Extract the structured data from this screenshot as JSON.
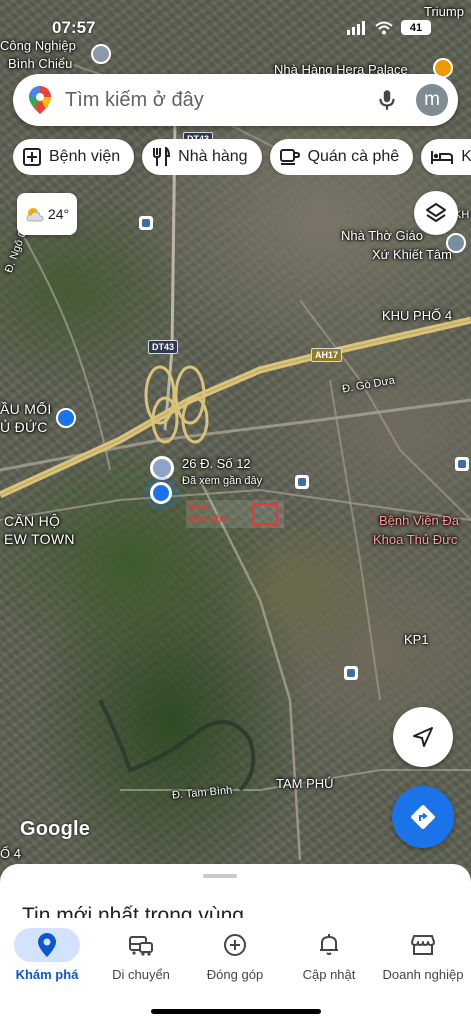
{
  "status_bar": {
    "time": "07:57",
    "battery": "41"
  },
  "search": {
    "placeholder": "Tìm kiếm ở đây",
    "avatar_letter": "m"
  },
  "chips": [
    {
      "label": "Bệnh viện",
      "icon": "hospital-icon"
    },
    {
      "label": "Nhà hàng",
      "icon": "restaurant-icon"
    },
    {
      "label": "Quán cà phê",
      "icon": "coffee-icon"
    },
    {
      "label": "Kh",
      "icon": "hotel-icon"
    }
  ],
  "weather": {
    "temp": "24°",
    "icon": "partly-cloudy-icon"
  },
  "map": {
    "labels": {
      "cong_nghiep": "Công Nghiệp",
      "binh_chieu": "Bình Chiểu",
      "triump": "Triump",
      "nha_hang_hera": "Nhà Hàng Hera Palace",
      "nha_tho_line1": "Nhà Thờ Giáo",
      "nha_tho_line2": "Xứ Khiết Tâm",
      "kh_right": "KH",
      "khu_pho_4": "KHU PHỐ 4",
      "ngo_chi_quoc": "Đ. Ngô Chí Quốc",
      "go_dua": "Đ. Gò Dưa",
      "cho_dau_moi_1": "ẦU MỐI",
      "cho_dau_moi_2": "Ủ ĐỨC",
      "pin_line1": "26 Đ. Số 12",
      "pin_line2": "Đã xem gần đây",
      "can_ho_1": "CĂN HỘ",
      "can_ho_2": "EW TOWN",
      "benh_vien_1": "Bệnh Viện Đa",
      "benh_vien_2": "Khoa Thủ Đức",
      "kp1": "KP1",
      "tam_phu": "TAM PHÚ",
      "tam_binh": "Đ. Tam Bình",
      "o4": "Ố 4",
      "watermark_1": "Mua",
      "watermark_2": "Bán nhà"
    },
    "shields": {
      "dt743": "DT43",
      "dt43": "DT43",
      "ah17": "AH17"
    },
    "colors": {
      "highway": "#d9c27a",
      "road": "#c9c4b5",
      "pin_blue": "#1a73e8"
    }
  },
  "google_logo": "Google",
  "sheet": {
    "title": "Tin mới nhất trong vùng"
  },
  "nav": [
    {
      "label": "Khám phá",
      "icon": "explore-pin-icon",
      "active": true
    },
    {
      "label": "Di chuyển",
      "icon": "commute-icon",
      "active": false
    },
    {
      "label": "Đóng góp",
      "icon": "add-circle-icon",
      "active": false
    },
    {
      "label": "Cập nhật",
      "icon": "bell-icon",
      "active": false
    },
    {
      "label": "Doanh nghiệp",
      "icon": "storefront-icon",
      "active": false
    }
  ]
}
